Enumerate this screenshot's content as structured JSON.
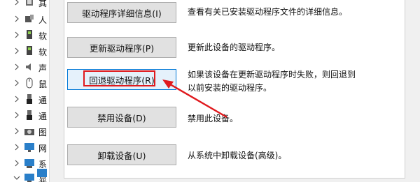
{
  "tree": {
    "items": [
      {
        "label": "其",
        "icon": "generic-device-icon",
        "chevron": "right"
      },
      {
        "label": "人",
        "icon": "human-interface-device-icon",
        "chevron": "right"
      },
      {
        "label": "软",
        "icon": "software-component-icon",
        "chevron": "right"
      },
      {
        "label": "软",
        "icon": "software-device-icon",
        "chevron": "right"
      },
      {
        "label": "声",
        "icon": "audio-device-icon",
        "chevron": "right"
      },
      {
        "label": "鼠",
        "icon": "mouse-icon",
        "chevron": "right"
      },
      {
        "label": "通",
        "icon": "usb-controller-icon",
        "chevron": "right"
      },
      {
        "label": "通",
        "icon": "usb-device-icon",
        "chevron": "right"
      },
      {
        "label": "图",
        "icon": "imaging-device-icon",
        "chevron": "right"
      },
      {
        "label": "网",
        "icon": "network-adapter-icon",
        "chevron": "right"
      },
      {
        "label": "系",
        "icon": "system-device-icon",
        "chevron": "right"
      },
      {
        "label": "显",
        "icon": "display-adapter-icon",
        "chevron": "down"
      }
    ]
  },
  "actions": [
    {
      "label": "驱动程序详细信息(I)",
      "description": [
        "查看有关已安装驱动程序文件的详细信息。"
      ]
    },
    {
      "label": "更新驱动程序(P)",
      "description": [
        "更新此设备的驱动程序。"
      ]
    },
    {
      "label": "回退驱动程序(R)",
      "description": [
        "如果该设备在更新驱动程序时失败，则回退到",
        "以前安装的驱动程序。"
      ]
    },
    {
      "label": "禁用设备(D)",
      "description": [
        "禁用此设备。"
      ]
    },
    {
      "label": "卸载设备(U)",
      "description": [
        "从系统中卸载设备(高级)。"
      ]
    }
  ],
  "annotation": {
    "color": "#e0191d"
  }
}
